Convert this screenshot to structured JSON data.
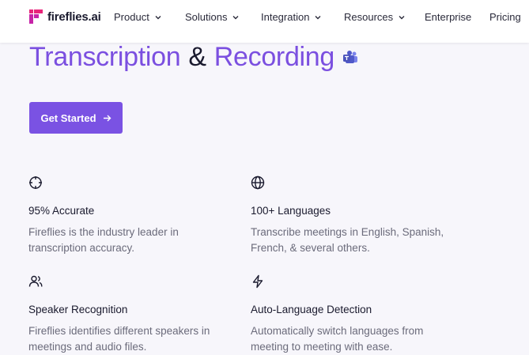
{
  "header": {
    "logo_text": "fireflies.ai",
    "nav": [
      {
        "label": "Product",
        "has_dropdown": true
      },
      {
        "label": "Solutions",
        "has_dropdown": true
      },
      {
        "label": "Integration",
        "has_dropdown": true
      },
      {
        "label": "Resources",
        "has_dropdown": true
      },
      {
        "label": "Enterprise",
        "has_dropdown": false
      },
      {
        "label": "Pricing",
        "has_dropdown": false
      }
    ]
  },
  "hero": {
    "title_part1": "Transcription",
    "title_amp": "&",
    "title_part2": "Recording",
    "title_icon": "microsoft-teams-icon",
    "cta_label": "Get Started",
    "cta_icon": "arrow-right-icon"
  },
  "features": [
    {
      "icon": "crosshair-icon",
      "title": "95% Accurate",
      "desc": "Fireflies is the industry leader in transcription accuracy."
    },
    {
      "icon": "globe-icon",
      "title": "100+ Languages",
      "desc": "Transcribe meetings in English, Spanish, French, & several others."
    },
    {
      "icon": "users-icon",
      "title": "Speaker Recognition",
      "desc": "Fireflies identifies different speakers in meetings and audio files."
    },
    {
      "icon": "lightning-icon",
      "title": "Auto-Language Detection",
      "desc": "Automatically switch languages from meeting to meeting with ease."
    }
  ],
  "colors": {
    "accent": "#7a52e3",
    "background": "#f7f6fb",
    "text": "#1a1a2e",
    "muted": "#6b6b7b"
  }
}
